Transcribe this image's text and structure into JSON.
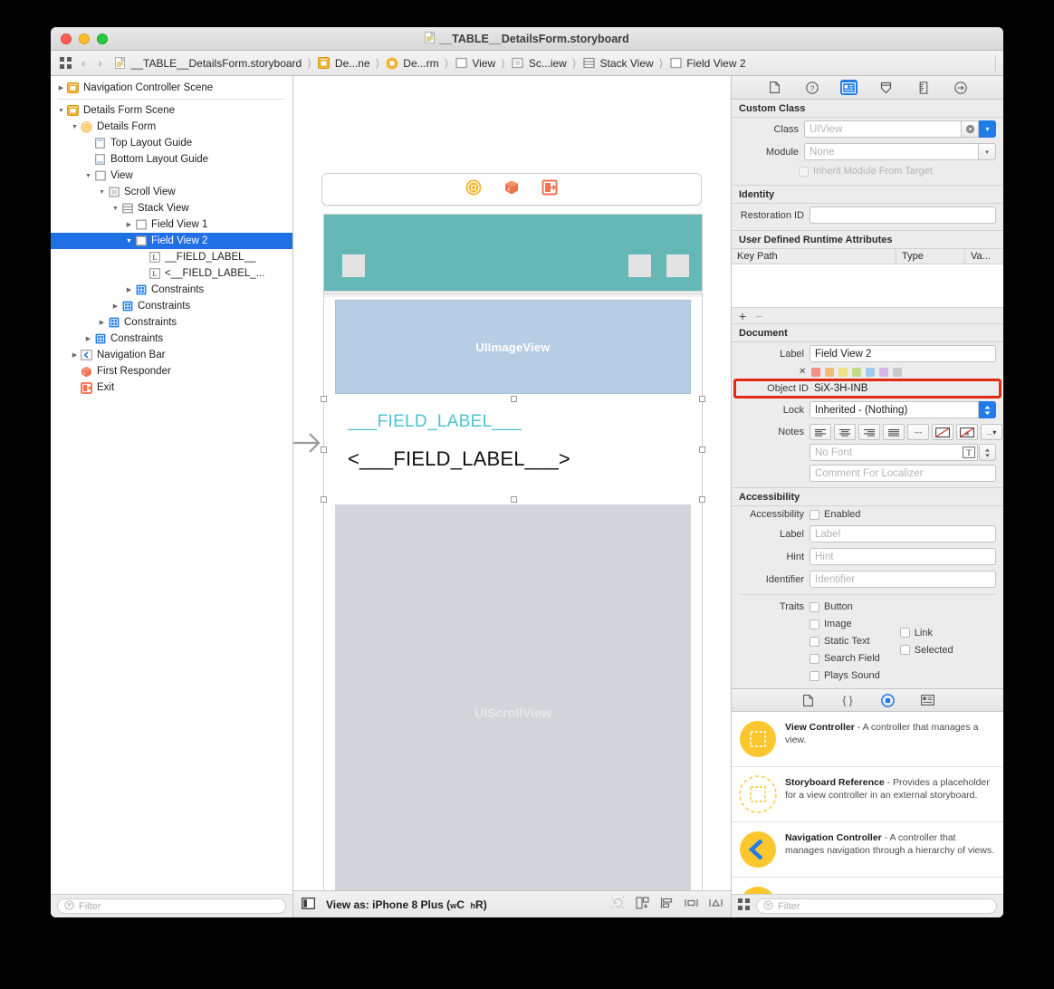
{
  "window": {
    "title": "__TABLE__DetailsForm.storyboard",
    "traffic": [
      "close",
      "minimize",
      "zoom"
    ]
  },
  "jumpbar": {
    "crumbs": [
      {
        "label": "__TABLE__DetailsForm.storyboard",
        "icon": "storyboard-file-icon"
      },
      {
        "label": "De...ne",
        "icon": "scene-icon"
      },
      {
        "label": "De...rm",
        "icon": "view-controller-icon"
      },
      {
        "label": "View",
        "icon": "view-icon"
      },
      {
        "label": "Sc...iew",
        "icon": "scroll-view-icon"
      },
      {
        "label": "Stack View",
        "icon": "stack-view-icon"
      },
      {
        "label": "Field View 2",
        "icon": "view-icon"
      }
    ]
  },
  "outline": {
    "rows": [
      {
        "label": "Navigation Controller Scene",
        "indent": 0,
        "twisty": "right",
        "icon": "scene",
        "selected": false
      },
      {
        "divider": true
      },
      {
        "label": "Details Form Scene",
        "indent": 0,
        "twisty": "down",
        "icon": "scene",
        "selected": false
      },
      {
        "label": "Details Form",
        "indent": 1,
        "twisty": "down",
        "icon": "vc",
        "selected": false
      },
      {
        "label": "Top Layout Guide",
        "indent": 2,
        "twisty": "none",
        "icon": "topguide",
        "selected": false
      },
      {
        "label": "Bottom Layout Guide",
        "indent": 2,
        "twisty": "none",
        "icon": "bottomguide",
        "selected": false
      },
      {
        "label": "View",
        "indent": 2,
        "twisty": "down",
        "icon": "view",
        "selected": false
      },
      {
        "label": "Scroll View",
        "indent": 3,
        "twisty": "down",
        "icon": "scrollview",
        "selected": false
      },
      {
        "label": "Stack View",
        "indent": 4,
        "twisty": "down",
        "icon": "stackview",
        "selected": false
      },
      {
        "label": "Field View 1",
        "indent": 5,
        "twisty": "right",
        "icon": "view",
        "selected": false
      },
      {
        "label": "Field View 2",
        "indent": 5,
        "twisty": "down",
        "icon": "view",
        "selected": true
      },
      {
        "label": "__FIELD_LABEL__",
        "indent": 6,
        "twisty": "none",
        "icon": "label",
        "selected": false
      },
      {
        "label": "<__FIELD_LABEL_...",
        "indent": 6,
        "twisty": "none",
        "icon": "label",
        "selected": false
      },
      {
        "label": "Constraints",
        "indent": 5,
        "twisty": "right",
        "icon": "constraints",
        "selected": false
      },
      {
        "label": "Constraints",
        "indent": 4,
        "twisty": "right",
        "icon": "constraints",
        "selected": false
      },
      {
        "label": "Constraints",
        "indent": 3,
        "twisty": "right",
        "icon": "constraints",
        "selected": false
      },
      {
        "label": "Constraints",
        "indent": 2,
        "twisty": "right",
        "icon": "constraints",
        "selected": false
      },
      {
        "label": "Navigation Bar",
        "indent": 1,
        "twisty": "right",
        "icon": "navbar",
        "selected": false
      },
      {
        "label": "First Responder",
        "indent": 1,
        "twisty": "none",
        "icon": "firstresponder",
        "selected": false
      },
      {
        "label": "Exit",
        "indent": 1,
        "twisty": "none",
        "icon": "exit",
        "selected": false
      }
    ],
    "filter_placeholder": "Filter"
  },
  "canvas": {
    "dock_icons": [
      "view-controller-icon",
      "first-responder-icon",
      "exit-icon"
    ],
    "image_view_label": "UIImageView",
    "field_label": "___FIELD_LABEL___",
    "field_value": "<___FIELD_LABEL___>",
    "scroll_view_label": "UIScrollView",
    "statusbar": {
      "view_as_prefix": "View as: ",
      "device": "iPhone 8 Plus",
      "traits": "(wC hR)",
      "trait_w": "w",
      "trait_c": "C",
      "trait_h": "h",
      "trait_r": "R"
    }
  },
  "inspector": {
    "tabs": [
      {
        "name": "file-inspector",
        "active": false
      },
      {
        "name": "quick-help-inspector",
        "active": false
      },
      {
        "name": "identity-inspector",
        "active": true
      },
      {
        "name": "attributes-inspector",
        "active": false
      },
      {
        "name": "size-inspector",
        "active": false
      },
      {
        "name": "connections-inspector",
        "active": false
      }
    ],
    "custom_class": {
      "header": "Custom Class",
      "class_label": "Class",
      "class_value": "UIView",
      "module_label": "Module",
      "module_value": "None",
      "inherit_label": "Inherit Module From Target"
    },
    "identity": {
      "header": "Identity",
      "restoration_label": "Restoration ID",
      "restoration_value": ""
    },
    "runtime_attributes": {
      "header": "User Defined Runtime Attributes",
      "columns": [
        "Key Path",
        "Type",
        "Va..."
      ],
      "rows": [],
      "add_label": "+",
      "remove_label": "−"
    },
    "document": {
      "header": "Document",
      "label_label": "Label",
      "label_value": "Field View 2",
      "swatch_colors": [
        "#ef8f87",
        "#f3bb7d",
        "#f0e085",
        "#bedb8c",
        "#9ecbf0",
        "#d8b6ea",
        "#c9c9c9"
      ],
      "object_id_label": "Object ID",
      "object_id_value": "SiX-3H-INB",
      "object_id_highlight_color": "#e02b12",
      "lock_label": "Lock",
      "lock_value": "Inherited - (Nothing)",
      "notes_label": "Notes",
      "font_placeholder": "No Font",
      "comment_placeholder": "Comment For Localizer"
    },
    "accessibility": {
      "header": "Accessibility",
      "accessibility_label": "Accessibility",
      "enabled_label": "Enabled",
      "label_label": "Label",
      "label_placeholder": "Label",
      "hint_label": "Hint",
      "hint_placeholder": "Hint",
      "identifier_label": "Identifier",
      "identifier_placeholder": "Identifier",
      "traits_label": "Traits",
      "traits_col1": [
        "Button",
        "Image",
        "Static Text",
        "Search Field",
        "Plays Sound"
      ],
      "traits_col2": [
        "Link",
        "Selected"
      ]
    }
  },
  "library": {
    "tabs": [
      {
        "name": "file-template-library",
        "active": false
      },
      {
        "name": "code-snippet-library",
        "active": false
      },
      {
        "name": "object-library",
        "active": true
      },
      {
        "name": "media-library",
        "active": false
      }
    ],
    "items": [
      {
        "title": "View Controller",
        "desc": " - A controller that manages a view.",
        "icon": "view-controller-solid-icon"
      },
      {
        "title": "Storyboard Reference",
        "desc": " - Provides a placeholder for a view controller in an external storyboard.",
        "icon": "storyboard-reference-icon"
      },
      {
        "title": "Navigation Controller",
        "desc": " - A controller that manages navigation through a hierarchy of views.",
        "icon": "navigation-controller-icon"
      }
    ],
    "filter_placeholder": "Filter"
  }
}
